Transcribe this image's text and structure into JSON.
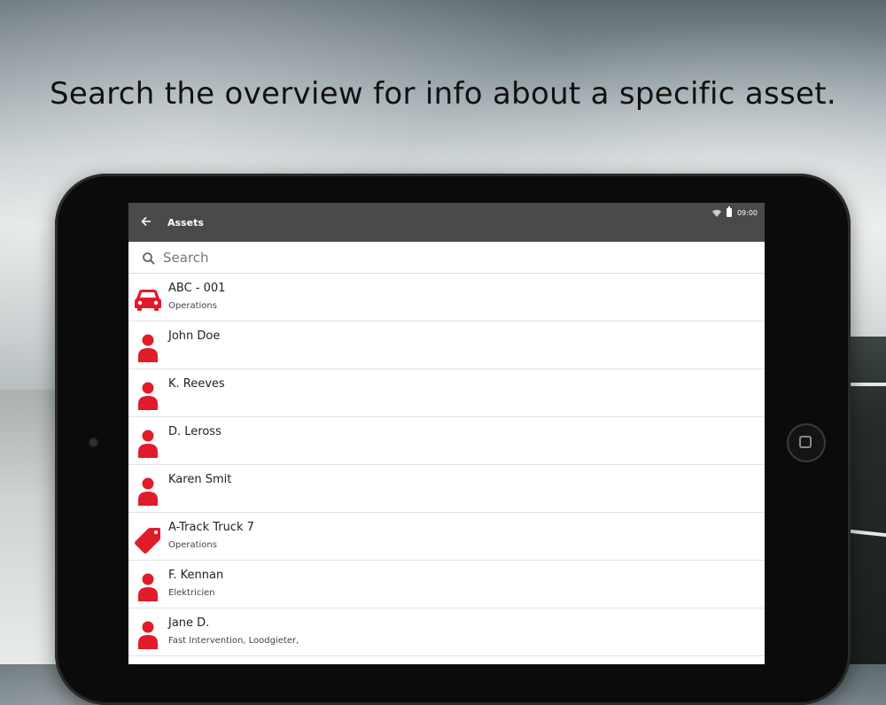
{
  "headline": "Search the overview for info about a specific asset.",
  "app": {
    "title": "Assets",
    "time": "09:00"
  },
  "search": {
    "placeholder": "Search"
  },
  "colors": {
    "accent_red": "#e11b2a",
    "appbar": "#4a4a4a"
  },
  "assets": [
    {
      "name": "ABC - 001",
      "sub": "Operations",
      "icon": "car-icon"
    },
    {
      "name": "John Doe",
      "sub": "",
      "icon": "person-icon"
    },
    {
      "name": "K. Reeves",
      "sub": "",
      "icon": "person-icon"
    },
    {
      "name": "D. Leross",
      "sub": "",
      "icon": "person-icon"
    },
    {
      "name": "Karen Smit",
      "sub": "",
      "icon": "person-icon"
    },
    {
      "name": "A-Track Truck 7",
      "sub": "Operations",
      "icon": "tag-icon"
    },
    {
      "name": "F. Kennan",
      "sub": "Elektricien",
      "icon": "person-icon"
    },
    {
      "name": "Jane D.",
      "sub": "Fast Intervention, Loodgieter,",
      "icon": "person-icon"
    }
  ]
}
